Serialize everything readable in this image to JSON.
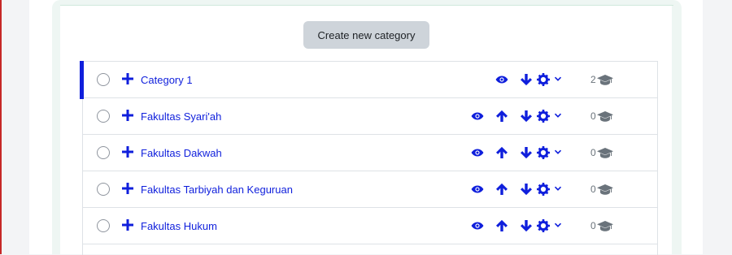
{
  "toolbar": {
    "create_label": "Create new category"
  },
  "colors": {
    "link": "#0f1fdc",
    "button_bg": "#ced4da",
    "muted": "#6a737b",
    "active_marker": "#0f1fdc"
  },
  "categories": [
    {
      "name": "Category 1",
      "count": "2",
      "active": true,
      "icons": [
        "eye-icon",
        "arrow-down-icon",
        "gear-icon",
        "chevron-down-icon"
      ]
    },
    {
      "name": "Fakultas Syari'ah",
      "count": "0",
      "active": false,
      "icons": [
        "eye-icon",
        "arrow-up-icon",
        "arrow-down-icon",
        "gear-icon",
        "chevron-down-icon"
      ]
    },
    {
      "name": "Fakultas Dakwah",
      "count": "0",
      "active": false,
      "icons": [
        "eye-icon",
        "arrow-up-icon",
        "arrow-down-icon",
        "gear-icon",
        "chevron-down-icon"
      ]
    },
    {
      "name": "Fakultas Tarbiyah dan Keguruan",
      "count": "0",
      "active": false,
      "icons": [
        "eye-icon",
        "arrow-up-icon",
        "arrow-down-icon",
        "gear-icon",
        "chevron-down-icon"
      ]
    },
    {
      "name": "Fakultas Hukum",
      "count": "0",
      "active": false,
      "icons": [
        "eye-icon",
        "arrow-up-icon",
        "arrow-down-icon",
        "gear-icon",
        "chevron-down-icon"
      ]
    }
  ]
}
